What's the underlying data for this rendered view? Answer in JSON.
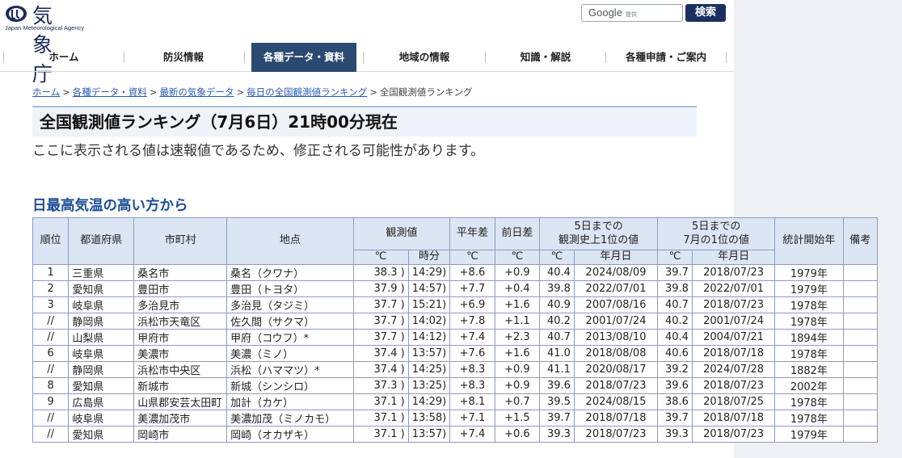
{
  "header": {
    "logo_name": "気象庁",
    "logo_sub": "Japan Meteorological Agency",
    "search_placeholder": "Google",
    "search_provided": "提供",
    "search_button": "検索"
  },
  "nav": [
    "ホーム",
    "防災情報",
    "各種データ・資料",
    "地域の情報",
    "知識・解説",
    "各種申請・ご案内"
  ],
  "breadcrumb": {
    "links": [
      "ホーム",
      "各種データ・資料",
      "最新の気象データ",
      "毎日の全国観測値ランキング"
    ],
    "current": "全国観測値ランキング",
    "sep": ">"
  },
  "page_title": "全国観測値ランキング（7月6日）21時00分現在",
  "notice": "ここに表示される値は速報値であるため、修正される可能性があります。",
  "section_title": "日最高気温の高い方から",
  "table": {
    "headers": {
      "rank": "順位",
      "prefecture": "都道府県",
      "city": "市町村",
      "station": "地点",
      "observed": "観測値",
      "normal_diff": "平年差",
      "prev_diff": "前日差",
      "record_all_1": "5日までの",
      "record_all_2": "観測史上1位の値",
      "record_july_1": "5日までの",
      "record_july_2": "7月の1位の値",
      "stats_start": "統計開始年",
      "remarks": "備考",
      "unit_c": "℃",
      "unit_time": "時分",
      "unit_date": "年月日"
    },
    "rows": [
      [
        "1",
        "三重県",
        "桑名市",
        "桑名（クワナ）",
        "38.3 )",
        "14:29)",
        "+8.6",
        "+0.9",
        "40.4",
        "2024/08/09",
        "39.7",
        "2018/07/23",
        "1979年",
        ""
      ],
      [
        "2",
        "愛知県",
        "豊田市",
        "豊田（トヨタ）",
        "37.9 )",
        "14:57)",
        "+7.7",
        "+0.4",
        "39.8",
        "2022/07/01",
        "39.8",
        "2022/07/01",
        "1979年",
        ""
      ],
      [
        "3",
        "岐阜県",
        "多治見市",
        "多治見（タジミ）",
        "37.7 )",
        "15:21)",
        "+6.9",
        "+1.6",
        "40.9",
        "2007/08/16",
        "40.7",
        "2018/07/23",
        "1978年",
        ""
      ],
      [
        "//",
        "静岡県",
        "浜松市天竜区",
        "佐久間（サクマ）",
        "37.7 )",
        "14:02)",
        "+7.8",
        "+1.1",
        "40.2",
        "2001/07/24",
        "40.2",
        "2001/07/24",
        "1978年",
        ""
      ],
      [
        "//",
        "山梨県",
        "甲府市",
        "甲府（コウフ）*",
        "37.7 )",
        "14:12)",
        "+7.4",
        "+2.3",
        "40.7",
        "2013/08/10",
        "40.4",
        "2004/07/21",
        "1894年",
        ""
      ],
      [
        "6",
        "岐阜県",
        "美濃市",
        "美濃（ミノ）",
        "37.4 )",
        "13:57)",
        "+7.6",
        "+1.6",
        "41.0",
        "2018/08/08",
        "40.6",
        "2018/07/18",
        "1978年",
        ""
      ],
      [
        "//",
        "静岡県",
        "浜松市中央区",
        "浜松（ハママツ）*",
        "37.4 )",
        "14:25)",
        "+8.3",
        "+0.9",
        "41.1",
        "2020/08/17",
        "39.2",
        "2024/07/28",
        "1882年",
        ""
      ],
      [
        "8",
        "愛知県",
        "新城市",
        "新城（シンシロ）",
        "37.3 )",
        "13:25)",
        "+8.3",
        "+0.9",
        "39.6",
        "2018/07/23",
        "39.6",
        "2018/07/23",
        "2002年",
        ""
      ],
      [
        "9",
        "広島県",
        "山県郡安芸太田町",
        "加計（カケ）",
        "37.1 )",
        "14:29)",
        "+8.1",
        "+0.7",
        "39.5",
        "2024/08/15",
        "38.6",
        "2018/07/25",
        "1978年",
        ""
      ],
      [
        "//",
        "岐阜県",
        "美濃加茂市",
        "美濃加茂（ミノカモ）",
        "37.1 )",
        "13:58)",
        "+7.1",
        "+1.5",
        "39.7",
        "2018/07/18",
        "39.7",
        "2018/07/18",
        "1978年",
        ""
      ],
      [
        "//",
        "愛知県",
        "岡崎市",
        "岡崎（オカザキ）",
        "37.1 )",
        "13:57)",
        "+7.4",
        "+0.6",
        "39.3",
        "2018/07/23",
        "39.3",
        "2018/07/23",
        "1979年",
        ""
      ]
    ]
  }
}
